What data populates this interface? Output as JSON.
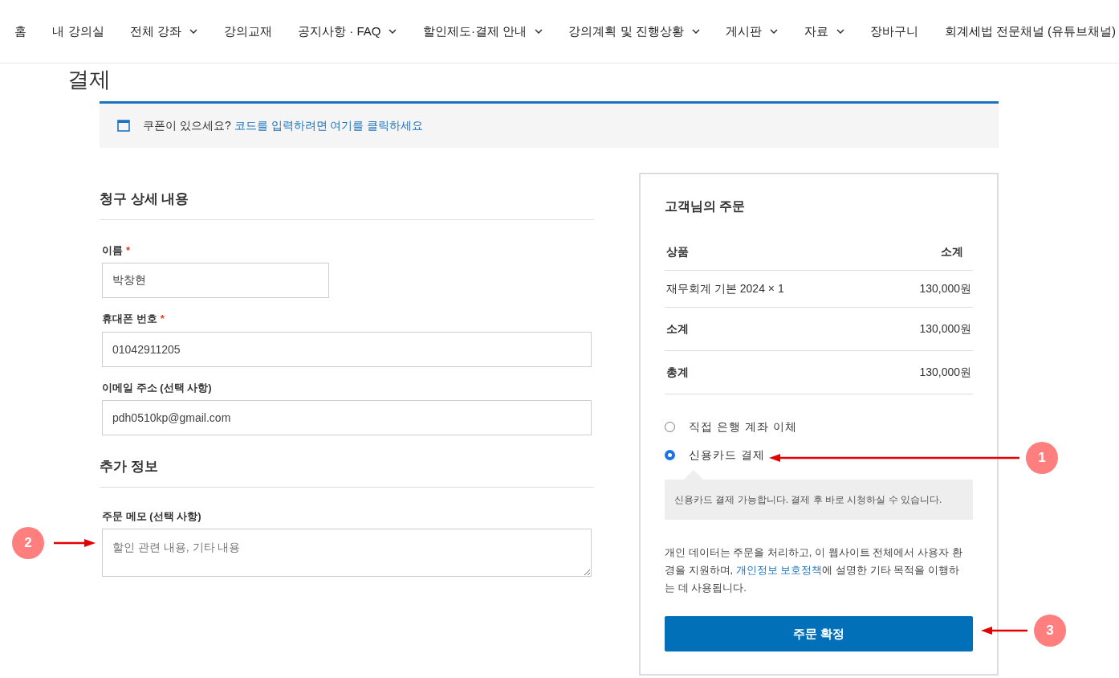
{
  "nav": [
    {
      "label": "홈",
      "dropdown": false
    },
    {
      "label": "내 강의실",
      "dropdown": false
    },
    {
      "label": "전체 강좌",
      "dropdown": true
    },
    {
      "label": "강의교재",
      "dropdown": false
    },
    {
      "label": "공지사항 · FAQ",
      "dropdown": true
    },
    {
      "label": "할인제도·결제 안내",
      "dropdown": true
    },
    {
      "label": "강의계획 및 진행상황",
      "dropdown": true
    },
    {
      "label": "게시판",
      "dropdown": true
    },
    {
      "label": "자료",
      "dropdown": true
    },
    {
      "label": "장바구니",
      "dropdown": false
    },
    {
      "label": "회계세법 전문채널 (유튜브채널)",
      "dropdown": false
    }
  ],
  "page_title": "결제",
  "coupon": {
    "text": "쿠폰이 있으세요?",
    "link": "코드를 입력하려면 여기를 클릭하세요"
  },
  "billing": {
    "heading": "청구 상세 내용",
    "fields": [
      {
        "label": "이름",
        "required_mark": "*",
        "value": "박창현"
      },
      {
        "label": "휴대폰 번호",
        "required_mark": "*",
        "value": "01042911205"
      },
      {
        "label": "이메일 주소 (선택 사항)",
        "value": "pdh0510kp@gmail.com"
      }
    ]
  },
  "additional": {
    "heading": "추가 정보",
    "memo": {
      "label": "주문 메모 (선택 사항)",
      "placeholder": "할인 관련 내용, 기타 내용"
    }
  },
  "order": {
    "heading": "고객님의 주문",
    "columns": [
      "상품",
      "소계"
    ],
    "rows": [
      {
        "kind": "item",
        "label": "재무회계 기본 2024 × 1",
        "value": "130,000원"
      },
      {
        "kind": "total",
        "label": "소계",
        "value": "130,000원"
      },
      {
        "kind": "total",
        "label": "총계",
        "value": "130,000원"
      }
    ],
    "payment_methods": [
      {
        "label": "직접 은행 계좌 이체",
        "selected": false
      },
      {
        "label": "신용카드 결제",
        "selected": true,
        "description": "신용카드 결제 가능합니다. 결제 후 바로 시청하실 수 있습니다."
      }
    ],
    "privacy": {
      "before": "개인 데이터는 주문을 처리하고, 이 웹사이트 전체에서 사용자 환경을 지원하며, ",
      "link": "개인정보 보호정책",
      "after": "에 설명한 기타 목적을 이행하는 데 사용됩니다."
    },
    "submit": "주문 확정"
  },
  "annotations": [
    {
      "label": "1"
    },
    {
      "label": "2"
    },
    {
      "label": "3"
    }
  ]
}
